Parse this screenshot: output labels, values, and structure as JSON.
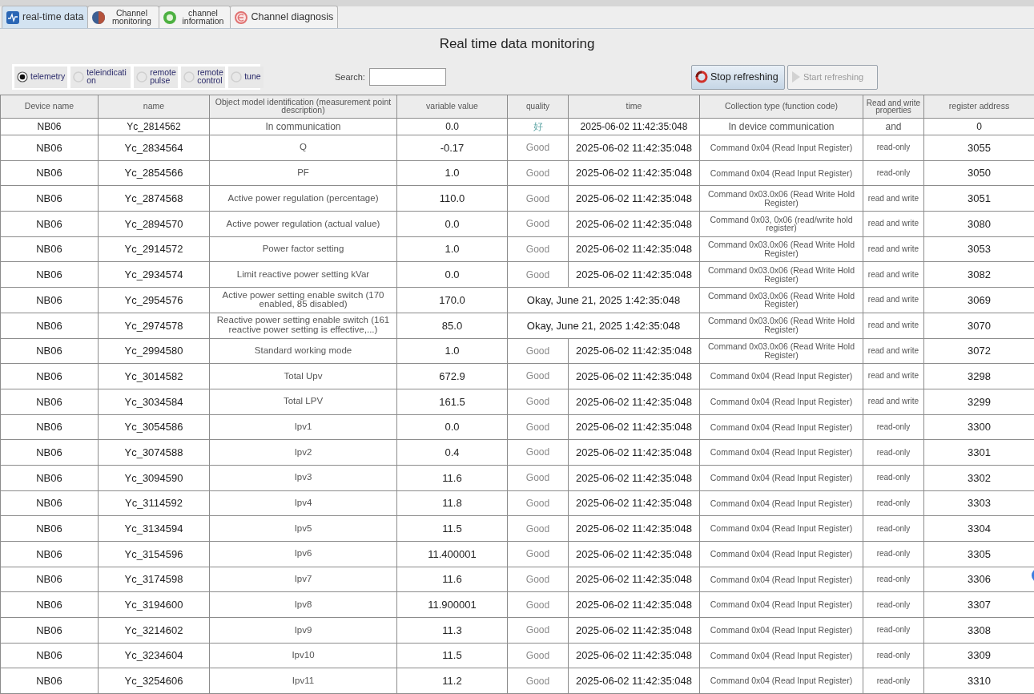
{
  "tabs": [
    {
      "label": "real-time data",
      "selected": true
    },
    {
      "label": "Channel monitoring",
      "selected": false
    },
    {
      "label": "channel information",
      "selected": false
    },
    {
      "label": "Channel diagnosis",
      "selected": false
    }
  ],
  "title": "Real time data monitoring",
  "point_types": [
    {
      "label": "telemetry",
      "selected": true
    },
    {
      "label": "teleindication",
      "selected": false
    },
    {
      "label": "remote pulse",
      "selected": false
    },
    {
      "label": "remote control",
      "selected": false
    },
    {
      "label": "tune",
      "selected": false
    }
  ],
  "search": {
    "label": "Search:"
  },
  "buttons": [
    {
      "label": "Stop refreshing",
      "kind": "stop",
      "disabled": false
    },
    {
      "label": "Start refreshing",
      "kind": "start",
      "disabled": true
    }
  ],
  "table": {
    "columns": [
      "Device name",
      "name",
      "Object model identification (measurement point description)",
      "variable value",
      "quality",
      "time",
      "Collection type (function code)",
      "Read and write properties",
      "register address"
    ],
    "rows": [
      {
        "device": "NB06",
        "name": "Yc_2814562",
        "description": "In communication",
        "value": "0.0",
        "quality": "好",
        "time": "2025-06-02 11:42:35:048",
        "collection_type": "In device communication",
        "access": "and",
        "register": "0"
      },
      {
        "device": "NB06",
        "name": "Yc_2834564",
        "description": "Q",
        "value": "-0.17",
        "quality": "Good",
        "time": "2025-06-02 11:42:35:048",
        "collection_type": "Command 0x04 (Read Input Register)",
        "access": "read-only",
        "register": "3055"
      },
      {
        "device": "NB06",
        "name": "Yc_2854566",
        "description": "PF",
        "value": "1.0",
        "quality": "Good",
        "time": "2025-06-02 11:42:35:048",
        "collection_type": "Command 0x04 (Read Input Register)",
        "access": "read-only",
        "register": "3050"
      },
      {
        "device": "NB06",
        "name": "Yc_2874568",
        "description": "Active power regulation (percentage)",
        "value": "110.0",
        "quality": "Good",
        "time": "2025-06-02 11:42:35:048",
        "collection_type": "Command 0x03.0x06 (Read Write Hold Register)",
        "access": "read and write",
        "register": "3051"
      },
      {
        "device": "NB06",
        "name": "Yc_2894570",
        "description": "Active power regulation (actual value)",
        "value": "0.0",
        "quality": "Good",
        "time": "2025-06-02 11:42:35:048",
        "collection_type": "Command 0x03, 0x06 (read/write hold register)",
        "access": "read and write",
        "register": "3080"
      },
      {
        "device": "NB06",
        "name": "Yc_2914572",
        "description": "Power factor setting",
        "value": "1.0",
        "quality": "Good",
        "time": "2025-06-02 11:42:35:048",
        "collection_type": "Command 0x03.0x06 (Read Write Hold Register)",
        "access": "read and write",
        "register": "3053"
      },
      {
        "device": "NB06",
        "name": "Yc_2934574",
        "description": "Limit reactive power setting kVar",
        "value": "0.0",
        "quality": "Good",
        "time": "2025-06-02 11:42:35:048",
        "collection_type": "Command 0x03.0x06 (Read Write Hold Register)",
        "access": "read and write",
        "register": "3082"
      },
      {
        "device": "NB06",
        "name": "Yc_2954576",
        "description": "Active power setting enable switch (170 enabled, 85 disabled)",
        "value": "170.0",
        "time": "Okay, June 21, 2025 1:42:35:048",
        "collection_type": "Command 0x03.0x06 (Read Write Hold Register)",
        "access": "read and write",
        "register": "3069"
      },
      {
        "device": "NB06",
        "name": "Yc_2974578",
        "description": "Reactive power setting enable switch (161 reactive power setting is effective,...)",
        "value": "85.0",
        "time": "Okay, June 21, 2025 1:42:35:048",
        "collection_type": "Command 0x03.0x06 (Read Write Hold Register)",
        "access": "read and write",
        "register": "3070"
      },
      {
        "device": "NB06",
        "name": "Yc_2994580",
        "description": "Standard working mode",
        "value": "1.0",
        "quality": "Good",
        "time": "2025-06-02 11:42:35:048",
        "collection_type": "Command 0x03.0x06 (Read Write Hold Register)",
        "access": "read and write",
        "register": "3072"
      },
      {
        "device": "NB06",
        "name": "Yc_3014582",
        "description": "Total Upv",
        "value": "672.9",
        "quality": "Good",
        "time": "2025-06-02 11:42:35:048",
        "collection_type": "Command 0x04 (Read Input Register)",
        "access": "read and write",
        "register": "3298"
      },
      {
        "device": "NB06",
        "name": "Yc_3034584",
        "description": "Total LPV",
        "value": "161.5",
        "quality": "Good",
        "time": "2025-06-02 11:42:35:048",
        "collection_type": "Command 0x04 (Read Input Register)",
        "access": "read and write",
        "register": "3299"
      },
      {
        "device": "NB06",
        "name": "Yc_3054586",
        "description": "Ipv1",
        "value": "0.0",
        "quality": "Good",
        "time": "2025-06-02 11:42:35:048",
        "collection_type": "Command 0x04 (Read Input Register)",
        "access": "read-only",
        "register": "3300"
      },
      {
        "device": "NB06",
        "name": "Yc_3074588",
        "description": "Ipv2",
        "value": "0.4",
        "quality": "Good",
        "time": "2025-06-02 11:42:35:048",
        "collection_type": "Command 0x04 (Read Input Register)",
        "access": "read-only",
        "register": "3301"
      },
      {
        "device": "NB06",
        "name": "Yc_3094590",
        "description": "Ipv3",
        "value": "11.6",
        "quality": "Good",
        "time": "2025-06-02 11:42:35:048",
        "collection_type": "Command 0x04 (Read Input Register)",
        "access": "read-only",
        "register": "3302"
      },
      {
        "device": "NB06",
        "name": "Yc_3114592",
        "description": "Ipv4",
        "value": "11.8",
        "quality": "Good",
        "time": "2025-06-02 11:42:35:048",
        "collection_type": "Command 0x04 (Read Input Register)",
        "access": "read-only",
        "register": "3303"
      },
      {
        "device": "NB06",
        "name": "Yc_3134594",
        "description": "Ipv5",
        "value": "11.5",
        "quality": "Good",
        "time": "2025-06-02 11:42:35:048",
        "collection_type": "Command 0x04 (Read Input Register)",
        "access": "read-only",
        "register": "3304"
      },
      {
        "device": "NB06",
        "name": "Yc_3154596",
        "description": "Ipv6",
        "value": "11.400001",
        "quality": "Good",
        "time": "2025-06-02 11:42:35:048",
        "collection_type": "Command 0x04 (Read Input Register)",
        "access": "read-only",
        "register": "3305"
      },
      {
        "device": "NB06",
        "name": "Yc_3174598",
        "description": "Ipv7",
        "value": "11.6",
        "quality": "Good",
        "time": "2025-06-02 11:42:35:048",
        "collection_type": "Command 0x04 (Read Input Register)",
        "access": "read-only",
        "register": "3306"
      },
      {
        "device": "NB06",
        "name": "Yc_3194600",
        "description": "Ipv8",
        "value": "11.900001",
        "quality": "Good",
        "time": "2025-06-02 11:42:35:048",
        "collection_type": "Command 0x04 (Read Input Register)",
        "access": "read-only",
        "register": "3307"
      },
      {
        "device": "NB06",
        "name": "Yc_3214602",
        "description": "Ipv9",
        "value": "11.3",
        "quality": "Good",
        "time": "2025-06-02 11:42:35:048",
        "collection_type": "Command 0x04 (Read Input Register)",
        "access": "read-only",
        "register": "3308"
      },
      {
        "device": "NB06",
        "name": "Yc_3234604",
        "description": "Ipv10",
        "value": "11.5",
        "quality": "Good",
        "time": "2025-06-02 11:42:35:048",
        "collection_type": "Command 0x04 (Read Input Register)",
        "access": "read-only",
        "register": "3309"
      },
      {
        "device": "NB06",
        "name": "Yc_3254606",
        "description": "Ipv11",
        "value": "11.2",
        "quality": "Good",
        "time": "2025-06-02 11:42:35:048",
        "collection_type": "Command 0x04 (Read Input Register)",
        "access": "read-only",
        "register": "3310"
      }
    ]
  }
}
